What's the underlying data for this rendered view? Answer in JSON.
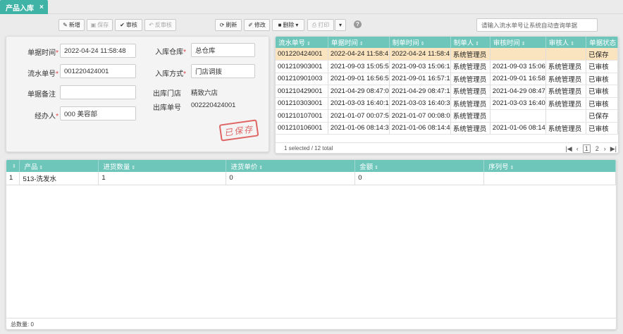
{
  "tab": {
    "label": "产品入库",
    "close": "×"
  },
  "toolbar": {
    "add": "新增",
    "save": "保存",
    "audit": "审核",
    "unaudit": "反审核",
    "refresh": "刷新",
    "edit": "修改",
    "delete": "删除",
    "print": "打印",
    "help": "?",
    "search_placeholder": "请输入流水单号让系统自动查询单据"
  },
  "form": {
    "date_label": "单据时间",
    "date_value": "2022-04-24 11:58:48",
    "serial_label": "流水单号",
    "serial_value": "001220424001",
    "remark_label": "单据备注",
    "remark_value": "",
    "handler_label": "经办人",
    "handler_value": "000 美容部",
    "warehouse_label": "入库仓库",
    "warehouse_value": "总仓库",
    "method_label": "入库方式",
    "method_value": "门店调拨",
    "out_store_label": "出库门店",
    "out_store_value": "精致六店",
    "out_no_label": "出库单号",
    "out_no_value": "002220424001",
    "stamp": "已保存",
    "required_mark": "*"
  },
  "grid": {
    "columns": [
      "流水单号",
      "单据时间",
      "制单时间",
      "制单人",
      "审核时间",
      "审核人",
      "单据状态"
    ],
    "rows": [
      [
        "001220424001",
        "2022-04-24 11:58:4",
        "2022-04-24 11:58:4",
        "系统管理员",
        "",
        "",
        "已保存"
      ],
      [
        "001210903001",
        "2021-09-03 15:05:5",
        "2021-09-03 15:06:1",
        "系统管理员",
        "2021-09-03 15:06",
        "系统管理员",
        "已审核"
      ],
      [
        "001210901003",
        "2021-09-01 16:56:5",
        "2021-09-01 16:57:1",
        "系统管理员",
        "2021-09-01 16:58",
        "系统管理员",
        "已审核"
      ],
      [
        "001210429001",
        "2021-04-29 08:47:0",
        "2021-04-29 08:47:1",
        "系统管理员",
        "2021-04-29 08:47",
        "系统管理员",
        "已审核"
      ],
      [
        "001210303001",
        "2021-03-03 16:40:1",
        "2021-03-03 16:40:3",
        "系统管理员",
        "2021-03-03 16:40",
        "系统管理员",
        "已审核"
      ],
      [
        "001210107001",
        "2021-01-07 00:07:5",
        "2021-01-07 00:08:0",
        "系统管理员",
        "",
        "",
        "已保存"
      ],
      [
        "001210106001",
        "2021-01-06 08:14:3",
        "2021-01-06 08:14:4",
        "系统管理员",
        "2021-01-06 08:14",
        "系统管理员",
        "已审核"
      ]
    ],
    "footer_text": "1 selected / 12 total",
    "pager": {
      "first": "|◀",
      "prev": "‹",
      "page1": "1",
      "page2": "2",
      "next": "›",
      "last": "▶|"
    }
  },
  "detail": {
    "columns": [
      "",
      "产品",
      "进货数量",
      "进货单价",
      "金额",
      "序列号"
    ],
    "rows": [
      [
        "1",
        "513-洗发水",
        "1",
        "0",
        "0",
        ""
      ]
    ],
    "footer_text": "总数量: 0"
  },
  "colors": {
    "accent": "#3fb3a6",
    "header": "#6ec6bb",
    "selected_row": "#fae4bf",
    "stamp": "#dd5555"
  }
}
